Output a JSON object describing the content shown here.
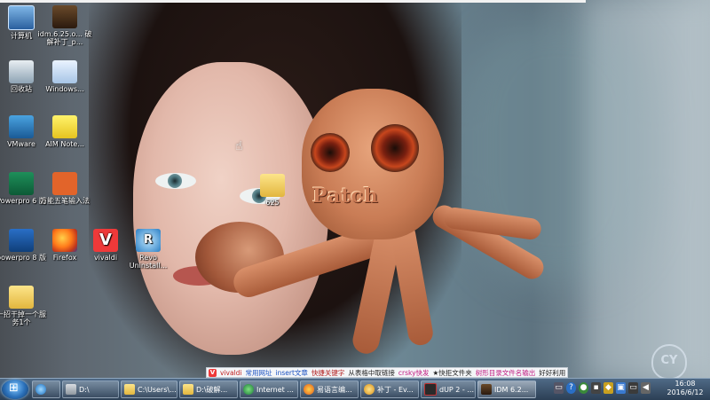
{
  "desktop": {
    "icons": [
      {
        "name": "computer",
        "label": "计算机",
        "icon": "computer-icon"
      },
      {
        "name": "idm-file",
        "label": "idm.6.25.o... 破解补丁_p...",
        "icon": "idm-patch-icon"
      },
      {
        "name": "recycle-bin",
        "label": "回收站",
        "icon": "recycle-bin-icon"
      },
      {
        "name": "windows-update",
        "label": "Windows...",
        "icon": "windows-icon"
      },
      {
        "name": "vmware",
        "label": "VMware",
        "icon": "vmware-icon"
      },
      {
        "name": "aim-note",
        "label": "AIM Note...",
        "icon": "note-icon"
      },
      {
        "name": "powerpro-6",
        "label": "Powerpro 6 版",
        "icon": "powerpro-icon"
      },
      {
        "name": "wanneng-input",
        "label": "万能五笔输入法",
        "icon": "input-method-icon"
      },
      {
        "name": "powerpro-8",
        "label": "powerpro 8 版",
        "icon": "powerpro8-icon"
      },
      {
        "name": "firefox",
        "label": "Firefox",
        "icon": "firefox-icon"
      },
      {
        "name": "vivaldi",
        "label": "vivaldi",
        "icon": "vivaldi-icon"
      },
      {
        "name": "revo",
        "label": "Revo Uninstall...",
        "icon": "revo-icon"
      },
      {
        "name": "folder-bottom",
        "label": "一招干掉一个服务1个",
        "icon": "folder-icon"
      },
      {
        "name": "folder-center",
        "label": "625",
        "icon": "folder-icon"
      }
    ],
    "wallpaper_text": "Patch"
  },
  "toolbar": {
    "items": [
      "vivaldi",
      "常用网址",
      "insert文章",
      "快捷关键字",
      "从表格中取链接",
      "crsky快发",
      "★快拒文件夹",
      "树形目录文件名输出",
      "好好利用"
    ]
  },
  "taskbar": {
    "items": [
      {
        "label": "",
        "icon": "ie-icon"
      },
      {
        "label": "D:\\",
        "icon": "drive-icon"
      },
      {
        "label": "C:\\Users\\...",
        "icon": "folder-icon"
      },
      {
        "label": "D:\\破解...",
        "icon": "folder-icon"
      },
      {
        "label": "Internet ...",
        "icon": "internet-icon"
      },
      {
        "label": "易语言编...",
        "icon": "firefox-icon"
      },
      {
        "label": "补丁 - Ev...",
        "icon": "search-icon"
      },
      {
        "label": "dUP 2 - ...",
        "icon": "dup-icon"
      },
      {
        "label": "IDM 6.2...",
        "icon": "idm-icon"
      }
    ],
    "clock_time": "16:08",
    "clock_date": "2016/6/12"
  },
  "colors": {
    "taskbar": "#2c3f55",
    "vivaldi_red": "#ef3939"
  }
}
